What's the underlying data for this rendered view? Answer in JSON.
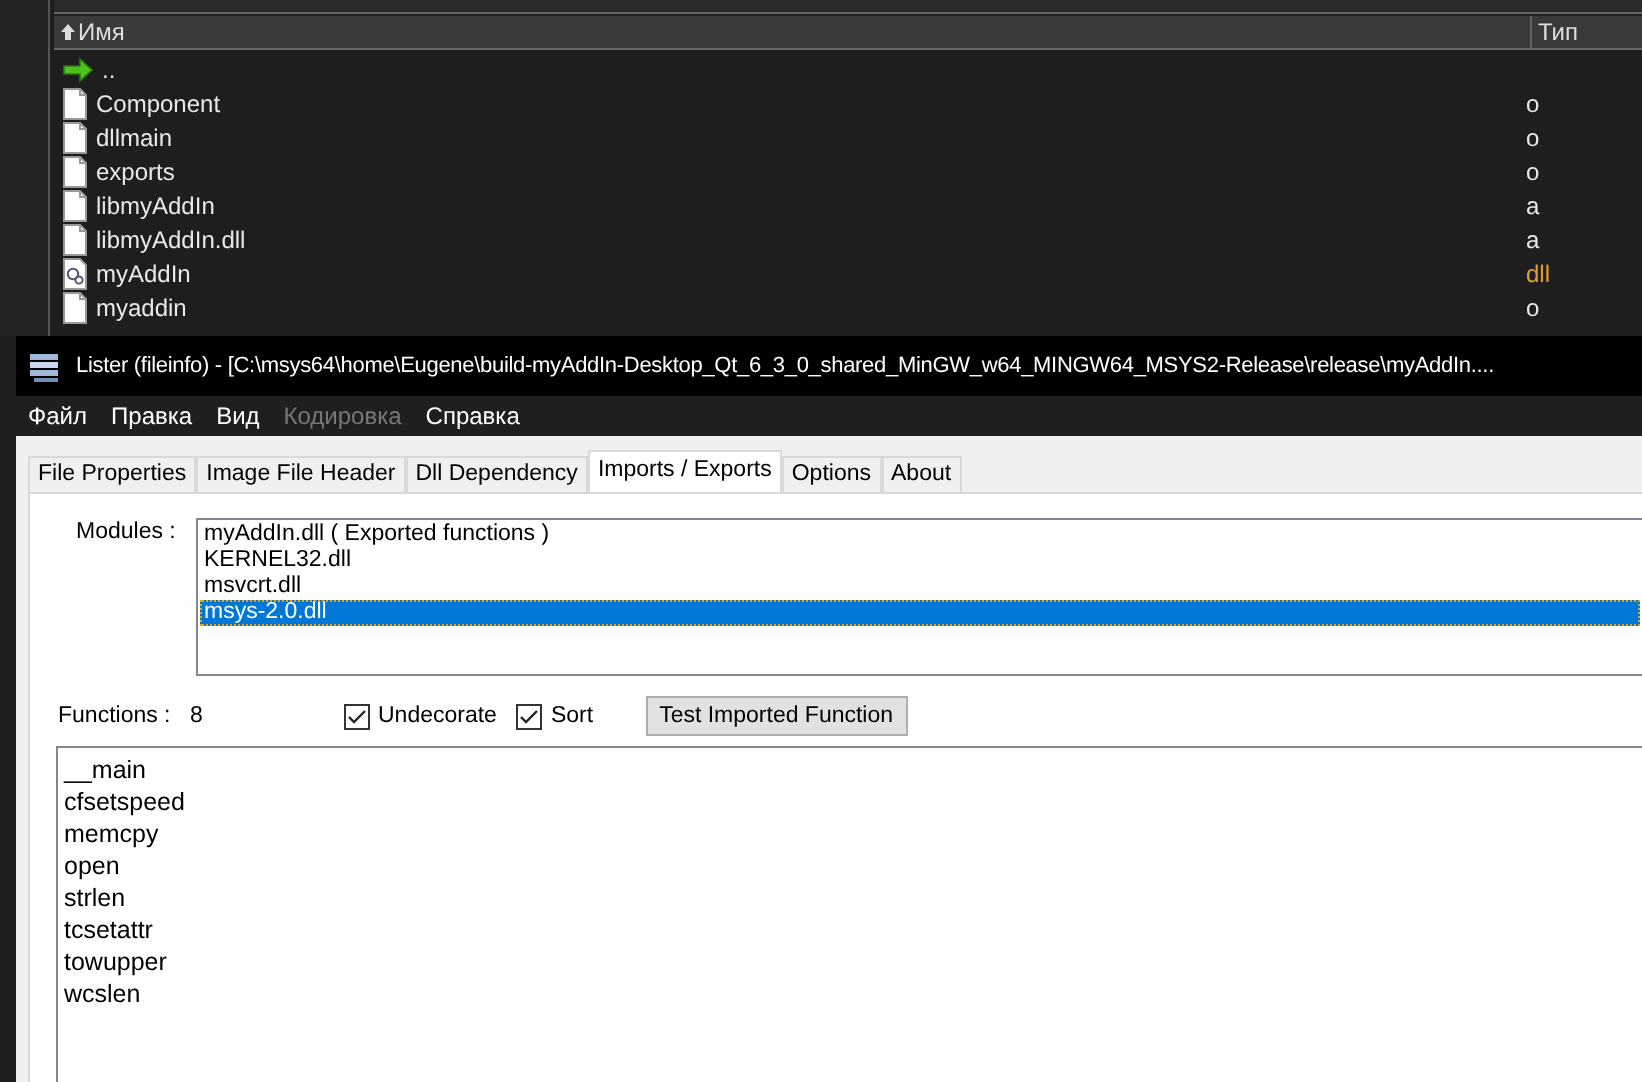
{
  "file_panel": {
    "columns": [
      {
        "label": "Имя",
        "sorted": true
      },
      {
        "label": "Тип"
      }
    ],
    "rows": [
      {
        "kind": "updir",
        "name": "..",
        "type": ""
      },
      {
        "kind": "file",
        "name": "Component",
        "type": "o"
      },
      {
        "kind": "file",
        "name": "dllmain",
        "type": "o"
      },
      {
        "kind": "file",
        "name": "exports",
        "type": "o"
      },
      {
        "kind": "file",
        "name": "libmyAddIn",
        "type": "a"
      },
      {
        "kind": "file",
        "name": "libmyAddIn.dll",
        "type": "a"
      },
      {
        "kind": "dll",
        "name": "myAddIn",
        "type": "dll"
      },
      {
        "kind": "file",
        "name": "myaddin",
        "type": "o"
      }
    ]
  },
  "window": {
    "title": "Lister (fileinfo) - [C:\\msys64\\home\\Eugene\\build-myAddIn-Desktop_Qt_6_3_0_shared_MinGW_w64_MINGW64_MSYS2-Release\\release\\myAddIn...."
  },
  "menu": [
    {
      "label": "Файл",
      "disabled": false
    },
    {
      "label": "Правка",
      "disabled": false
    },
    {
      "label": "Вид",
      "disabled": false
    },
    {
      "label": "Кодировка",
      "disabled": true
    },
    {
      "label": "Справка",
      "disabled": false
    }
  ],
  "tabs": [
    {
      "label": "File Properties",
      "selected": false
    },
    {
      "label": "Image File Header",
      "selected": false
    },
    {
      "label": "Dll Dependency",
      "selected": false
    },
    {
      "label": "Imports / Exports",
      "selected": true
    },
    {
      "label": "Options",
      "selected": false
    },
    {
      "label": "About",
      "selected": false
    }
  ],
  "modules": {
    "label": "Modules :",
    "items": [
      {
        "label": "myAddIn.dll  ( Exported functions )",
        "selected": false
      },
      {
        "label": "KERNEL32.dll",
        "selected": false
      },
      {
        "label": "msvcrt.dll",
        "selected": false
      },
      {
        "label": "msys-2.0.dll",
        "selected": true
      }
    ]
  },
  "functions": {
    "label": "Functions :",
    "count": "8",
    "options": [
      {
        "label": "Undecorate",
        "checked": true
      },
      {
        "label": "Sort",
        "checked": true
      }
    ],
    "button": "Test Imported Function",
    "items": [
      "__main",
      "cfsetspeed",
      "memcpy",
      "open",
      "strlen",
      "tcsetattr",
      "towupper",
      "wcslen"
    ]
  }
}
